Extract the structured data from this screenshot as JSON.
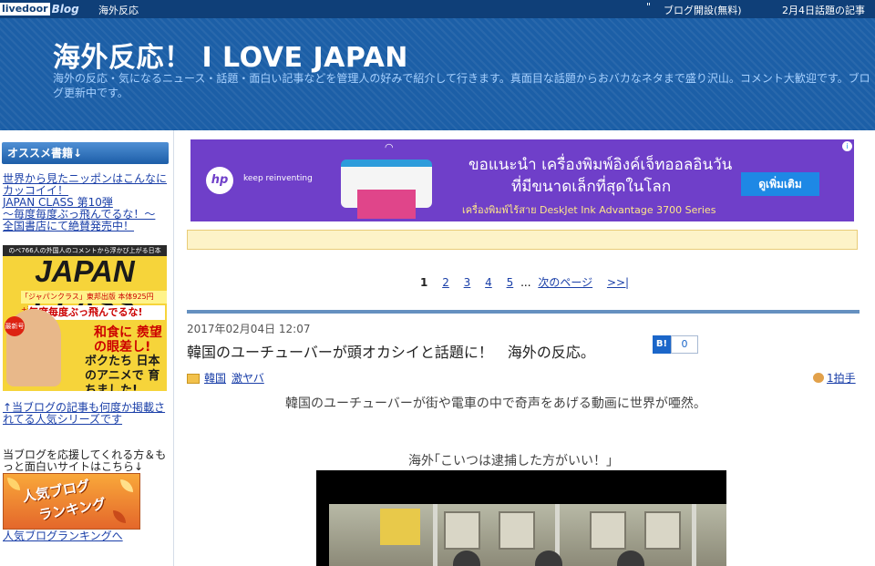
{
  "topbar": {
    "logo_livedoor": "livedoor",
    "logo_blog": "Blog",
    "site_name": "海外反応",
    "quote_mark": "\"",
    "open_blog": "ブログ開設(無料)",
    "daily_topic": "2月4日話題の記事"
  },
  "header": {
    "title": "海外反応！ I LOVE JAPAN",
    "description": "海外の反応・気になるニュース・話題・面白い記事などを管理人の好みで紹介して行きます。真面目な話題からおバカなネタまで盛り沢山。コメント大歓迎です。ブログ更新中です。"
  },
  "sidebar": {
    "section_title": "オススメ書籍↓",
    "book_links": [
      "世界から見たニッポンはこんなにカッコイイ！",
      "JAPAN CLASS 第10弾",
      "〜毎度毎度ぶっ飛んでるな！〜",
      "全国書店にて絶賛発売中！"
    ],
    "banner": {
      "top_strip": "のべ766人の外国人のコメントから浮かび上がる日本",
      "big_title": "JAPAN CLASS",
      "sub_line": "「ジャパンクラス」東邦出版 本体925円+税",
      "catch": "毎度毎度ぶっ飛んでるな!",
      "badge": "最新号",
      "feature1": "和食に 羨望の眼差し!",
      "feature2": "ボクたち 日本のアニメで 育ちました!"
    },
    "recommend_link": "↑当ブログの記事も何度か掲載されてる人気シリーズです",
    "support_text": "当ブログを応援してくれる方＆もっと面白いサイトはこちら↓",
    "ranking_image_line1": "人気ブログ",
    "ranking_image_line2": "ランキング",
    "ranking_link": "人気ブログランキングへ"
  },
  "ad": {
    "brand": "hp",
    "tagline": "keep reinventing",
    "headline1": "ขอแนะนำ เครื่องพิมพ์อิงค์เจ็ทออลอินวัน",
    "headline2": "ที่มีขนาดเล็กที่สุดในโลก",
    "subline": "เครื่องพิมพ์ไร้สาย DeskJet Ink Advantage 3700 Series",
    "cta": "ดูเพิ่มเติม",
    "info": "i"
  },
  "pager": {
    "current": "1",
    "pages": [
      "2",
      "3",
      "4",
      "5"
    ],
    "ellipsis": "...",
    "next": "次のページ",
    "last": ">>|"
  },
  "article": {
    "date": "2017年02月04日 12:07",
    "title": "韓国のユーチューバーが頭オカシイと話題に！　海外の反応。",
    "hatena_label": "B!",
    "hatena_count": "0",
    "categories": [
      "韓国",
      "激ヤバ"
    ],
    "hakushu": "1拍手",
    "lead": "韓国のユーチューバーが街や電車の中で奇声をあげる動画に世界が唖然。",
    "quote": "海外｢こいつは逮捕した方がいい！｣"
  }
}
